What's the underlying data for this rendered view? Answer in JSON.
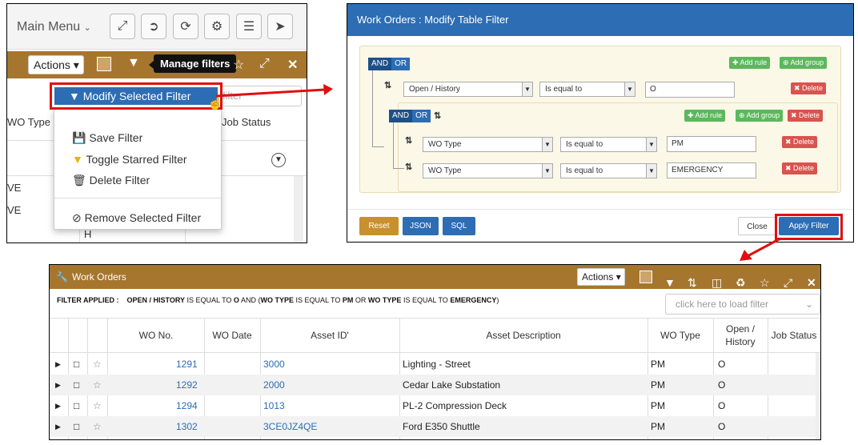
{
  "panel1": {
    "main_menu": "Main Menu",
    "actions": "Actions",
    "tooltip": "Manage filters",
    "search_placeholder": "filter",
    "col_wo_type": "WO Type",
    "col_job_status": "Job Status",
    "cells": [
      "VE",
      "VE"
    ],
    "cell_h": "H",
    "menu": {
      "modify": "Modify Selected Filter",
      "save": "Save Filter",
      "toggle": "Toggle Starred Filter",
      "delete": "Delete Filter",
      "remove": "Remove Selected Filter"
    }
  },
  "panel2": {
    "title": "Work Orders : Modify Table Filter",
    "and": "AND",
    "or": "OR",
    "add_rule": "Add rule",
    "add_group": "Add group",
    "delete": "Delete",
    "rule1": {
      "field": "Open / History",
      "op": "Is equal to",
      "value": "O"
    },
    "rule2": {
      "field": "WO Type",
      "op": "Is equal to",
      "value": "PM"
    },
    "rule3": {
      "field": "WO Type",
      "op": "Is equal to",
      "value": "EMERGENCY"
    },
    "buttons": {
      "reset": "Reset",
      "json": "JSON",
      "sql": "SQL",
      "close": "Close",
      "apply": "Apply Filter"
    },
    "colors": {
      "reset": "#c9902e",
      "json": "#2d6db3",
      "apply": "#2d6db3"
    }
  },
  "panel3": {
    "title": "Work Orders",
    "actions": "Actions",
    "filter_label": "FILTER APPLIED :",
    "f_open": "OPEN / HISTORY",
    "f_eq": "IS EQUAL TO",
    "f_o": "O",
    "f_and": "AND",
    "f_wotype": "WO TYPE",
    "f_pm": "PM",
    "f_or": "OR",
    "f_emergency": "EMERGENCY",
    "load_placeholder": "click here to load filter",
    "headers": [
      "WO No.",
      "WO Date",
      "Asset ID'",
      "Asset Description",
      "WO Type",
      "Open / History",
      "Job Status"
    ],
    "rows": [
      {
        "wo_no": "1291",
        "asset_id": "3000",
        "desc": "Lighting - Street",
        "wo_type": "PM",
        "open": "O"
      },
      {
        "wo_no": "1292",
        "asset_id": "2000",
        "desc": "Cedar Lake Substation",
        "wo_type": "PM",
        "open": "O"
      },
      {
        "wo_no": "1294",
        "asset_id": "1013",
        "desc": "PL-2 Compression Deck",
        "wo_type": "PM",
        "open": "O"
      },
      {
        "wo_no": "1302",
        "asset_id": "3CE0JZ4QE",
        "desc": "Ford E350 Shuttle",
        "wo_type": "PM",
        "open": "O"
      }
    ]
  },
  "icons": [
    "shuffle-icon",
    "logout-icon",
    "refresh-icon",
    "gear-icon",
    "menu-icon",
    "navigate-icon",
    "funnel-icon",
    "star-icon",
    "expand-icon",
    "close-icon",
    "wrench-icon",
    "sort-icon",
    "columns-icon",
    "recycle-icon"
  ]
}
